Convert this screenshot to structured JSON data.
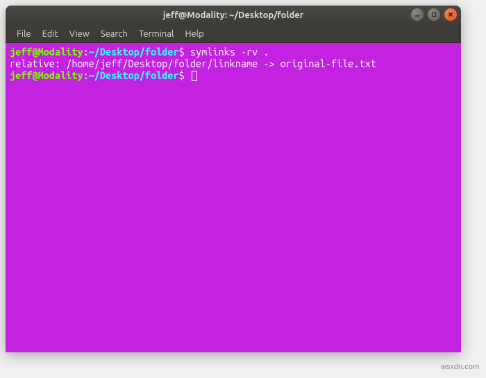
{
  "window": {
    "title": "jeff@Modality: ~/Desktop/folder"
  },
  "menubar": {
    "items": [
      {
        "label": "File"
      },
      {
        "label": "Edit"
      },
      {
        "label": "View"
      },
      {
        "label": "Search"
      },
      {
        "label": "Terminal"
      },
      {
        "label": "Help"
      }
    ]
  },
  "terminal": {
    "lines": [
      {
        "prompt": {
          "user": "jeff@Modality",
          "colon": ":",
          "path": "~/Desktop/folder",
          "dollar": "$ "
        },
        "command": "symlinks -rv ."
      },
      {
        "output": "relative: /home/jeff/Desktop/folder/linkname -> original-file.txt"
      },
      {
        "prompt": {
          "user": "jeff@Modality",
          "colon": ":",
          "path": "~/Desktop/folder",
          "dollar": "$ "
        },
        "cursor": true
      }
    ]
  },
  "watermark": "wsxdn.com"
}
